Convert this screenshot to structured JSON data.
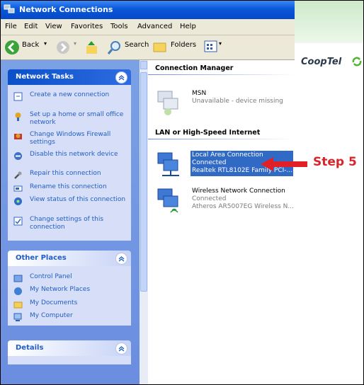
{
  "window": {
    "title": "Network Connections"
  },
  "menu": [
    "File",
    "Edit",
    "View",
    "Favorites",
    "Tools",
    "Advanced",
    "Help"
  ],
  "toolbar": {
    "back": "Back",
    "search": "Search",
    "folders": "Folders"
  },
  "network_tasks": {
    "title": "Network Tasks",
    "items": [
      {
        "label": "Create a new connection",
        "icon": "new-connection-icon"
      },
      {
        "label": "Set up a home or small office network",
        "icon": "home-network-icon"
      },
      {
        "label": "Change Windows Firewall settings",
        "icon": "firewall-icon"
      },
      {
        "label": "Disable this network device",
        "icon": "disable-icon"
      },
      {
        "label": "Repair this connection",
        "icon": "repair-icon"
      },
      {
        "label": "Rename this connection",
        "icon": "rename-icon"
      },
      {
        "label": "View status of this connection",
        "icon": "status-icon"
      },
      {
        "label": "Change settings of this connection",
        "icon": "settings-icon"
      }
    ]
  },
  "other_places": {
    "title": "Other Places",
    "items": [
      {
        "label": "Control Panel",
        "icon": "control-panel-icon"
      },
      {
        "label": "My Network Places",
        "icon": "network-places-icon"
      },
      {
        "label": "My Documents",
        "icon": "documents-icon"
      },
      {
        "label": "My Computer",
        "icon": "computer-icon"
      }
    ]
  },
  "details": {
    "title": "Details"
  },
  "groups": {
    "connection_manager": "Connection Manager",
    "lan": "LAN or High-Speed Internet"
  },
  "connections": [
    {
      "name": "MSN",
      "status": "Unavailable - device missing",
      "device": "",
      "icon": "msn-connection-icon"
    },
    {
      "name": "Local Area Connection",
      "status": "Connected",
      "device": "Realtek RTL8102E Family PCI-...",
      "icon": "lan-connection-icon"
    },
    {
      "name": "Wireless Network Connection",
      "status": "Connected",
      "device": "Atheros AR5007EG Wireless N...",
      "icon": "wireless-connection-icon"
    }
  ],
  "brand": {
    "logo": "CoopTel",
    "step_label": "Step 5"
  },
  "colors": {
    "title_blue": "#0a57d8",
    "task_blue": "#215dc6",
    "selection": "#316ac5",
    "step_red": "#d7262b"
  }
}
